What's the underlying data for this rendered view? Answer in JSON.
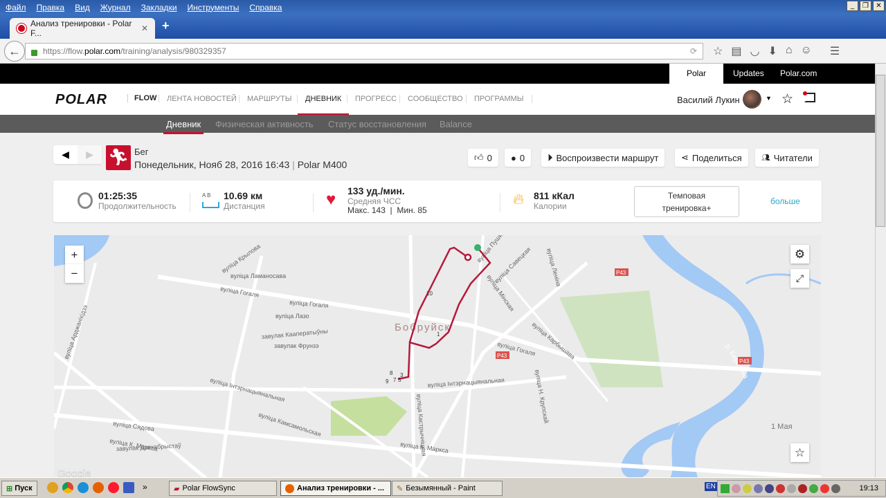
{
  "browser": {
    "menu": [
      "Файл",
      "Правка",
      "Вид",
      "Журнал",
      "Закладки",
      "Инструменты",
      "Справка"
    ],
    "tab_title": "Анализ тренировки - Polar F...",
    "url_prefix": "https://flow.",
    "url_domain": "polar.com",
    "url_path": "/training/analysis/980329357"
  },
  "topbar": {
    "tabs": [
      "Polar Flow",
      "Updates",
      "Polar.com"
    ]
  },
  "header": {
    "logo": "POLAR",
    "logo_sub": "FLOW",
    "nav": [
      "ЛЕНТА НОВОСТЕЙ",
      "МАРШРУТЫ",
      "ДНЕВНИК",
      "ПРОГРЕСС",
      "СООБЩЕСТВО",
      "ПРОГРАММЫ"
    ],
    "active_nav": "ДНЕВНИК",
    "user": "Василий Лукин"
  },
  "subnav": [
    "Дневник",
    "Физическая активность",
    "Статус восстановления",
    "Balance"
  ],
  "session": {
    "sport": "Бег",
    "datetime": "Понедельник, Нояб 28, 2016 16:43",
    "separator": "|",
    "device": "Polar M400"
  },
  "actions": {
    "likes": "0",
    "comments": "0",
    "replay": "Воспроизвести маршрут",
    "share": "Поделиться",
    "followers": "Читатели"
  },
  "stats": {
    "duration": {
      "value": "01:25:35",
      "label": "Продолжительность"
    },
    "distance": {
      "value": "10.69 км",
      "label": "Дистанция",
      "ab": "A  B"
    },
    "heart": {
      "value": "133 уд./мин.",
      "label": "Средняя ЧСС",
      "minmax": "Макс. 143  |  Мин. 85"
    },
    "calories": {
      "value": "811 кКал",
      "label": "Калории"
    },
    "benefit": "Темповая тренировка+",
    "more": "больше"
  },
  "map": {
    "city": "Бобруйск",
    "river": "р. Березина",
    "village": "1 Мая",
    "road": "P43",
    "attribution": "Google",
    "streets": [
      "вуліца Гогаля",
      "вуліца Гогаля",
      "вуліца Гогаля",
      "вуліца Крылова",
      "вуліца Ламаносава",
      "вуліца Лазо",
      "завулак Кааператыўны",
      "завулак Фрунзэ",
      "вуліца Інтэрнацыянальная",
      "вуліца Інтэрнацыянальная",
      "вуліца Камсамольская",
      "вуліца К. Маркса",
      "вуліца К. Маркса",
      "вуліца Сядова",
      "завулак Дзекабрыстаў",
      "вуліца Мінская",
      "вуліца Карбышава",
      "вуліца Пушкіна",
      "вуліца Савецкая",
      "вуліца Леніна",
      "вуліца Н. Крупскай",
      "вуліца Кастрычніцкая",
      "вуліца Арджанікідзэ"
    ],
    "markers": [
      "10",
      "1",
      "8",
      "9",
      "7",
      "5",
      "3"
    ]
  },
  "taskbar": {
    "start": "Пуск",
    "tasks": [
      "Polar FlowSync",
      "Анализ тренировки - ...",
      "Безымянный - Paint"
    ],
    "lang": "EN",
    "clock": "19:13"
  }
}
